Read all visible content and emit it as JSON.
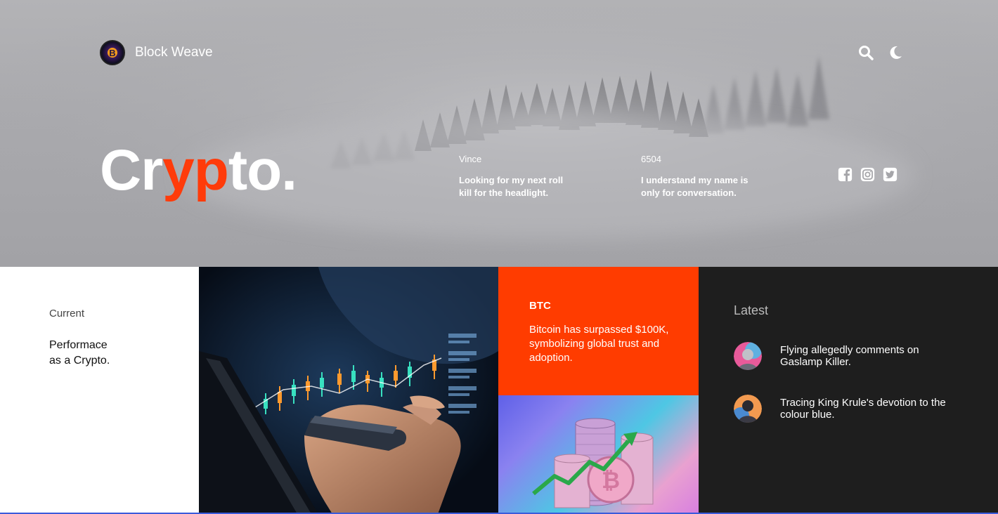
{
  "brand": {
    "name": "Block Weave",
    "logo_icon": "bitcoin-logo",
    "logo_glyph": "B"
  },
  "nav": {
    "icons": [
      "search-icon",
      "moon-icon"
    ]
  },
  "hero": {
    "title_start": "Cr",
    "title_accent": "yp",
    "title_end": "to.",
    "accent_color": "#ff3b0a",
    "quotes": [
      {
        "author": "Vince",
        "text": "Looking for my next roll kill for the headlight."
      },
      {
        "author": "6504",
        "text": "I understand my name is only for conversation."
      }
    ],
    "socials": [
      "facebook-icon",
      "instagram-icon",
      "twitter-icon"
    ]
  },
  "current": {
    "label": "Current",
    "text": "Performace as a Crypto."
  },
  "btc": {
    "title": "BTC",
    "text": "Bitcoin has surpassed $100K, symbolizing global trust and adoption.",
    "bg_color": "#ff3c00"
  },
  "latest": {
    "title": "Latest",
    "items": [
      {
        "text": "Flying allegedly comments on Gaslamp Killer."
      },
      {
        "text": "Tracing King Krule's devotion to the colour blue."
      }
    ]
  }
}
